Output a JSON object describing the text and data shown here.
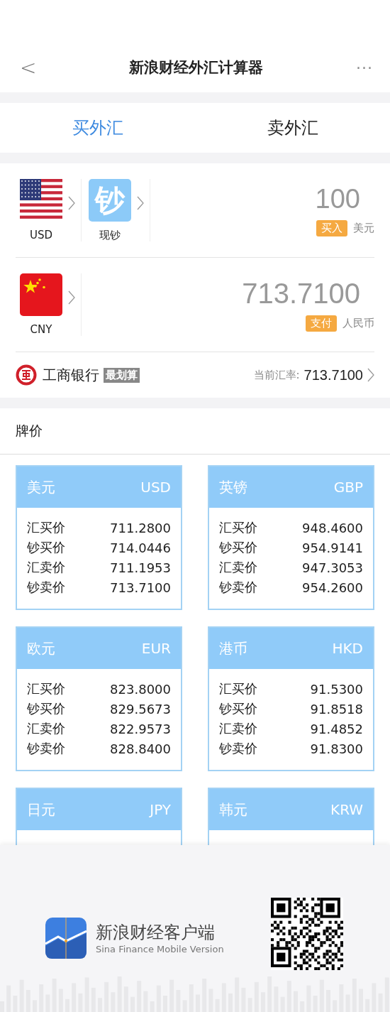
{
  "header": {
    "back": "<",
    "title": "新浪财经外汇计算器",
    "more": "···"
  },
  "tabs": [
    {
      "label": "买外汇",
      "selected": true
    },
    {
      "label": "卖外汇",
      "selected": false
    }
  ],
  "converter": {
    "from": {
      "code": "USD",
      "type_char": "钞",
      "type_label": "现钞",
      "amount": "100",
      "action": "买入",
      "currency": "美元"
    },
    "to": {
      "code": "CNY",
      "amount": "713.7100",
      "action": "支付",
      "currency": "人民币"
    },
    "bank": {
      "name": "工商银行",
      "tag": "最划算",
      "rate_label": "当前汇率:",
      "rate": "713.7100"
    }
  },
  "prices": {
    "title": "牌价",
    "cards": [
      {
        "name": "美元",
        "code": "USD",
        "rows": [
          {
            "label": "汇买价",
            "value": "711.2800"
          },
          {
            "label": "钞买价",
            "value": "714.0446"
          },
          {
            "label": "汇卖价",
            "value": "711.1953"
          },
          {
            "label": "钞卖价",
            "value": "713.7100"
          }
        ]
      },
      {
        "name": "英镑",
        "code": "GBP",
        "rows": [
          {
            "label": "汇买价",
            "value": "948.4600"
          },
          {
            "label": "钞买价",
            "value": "954.9141"
          },
          {
            "label": "汇卖价",
            "value": "947.3053"
          },
          {
            "label": "钞卖价",
            "value": "954.2600"
          }
        ]
      },
      {
        "name": "欧元",
        "code": "EUR",
        "rows": [
          {
            "label": "汇买价",
            "value": "823.8000"
          },
          {
            "label": "钞买价",
            "value": "829.5673"
          },
          {
            "label": "汇卖价",
            "value": "822.9573"
          },
          {
            "label": "钞卖价",
            "value": "828.8400"
          }
        ]
      },
      {
        "name": "港币",
        "code": "HKD",
        "rows": [
          {
            "label": "汇买价",
            "value": "91.5300"
          },
          {
            "label": "钞买价",
            "value": "91.8518"
          },
          {
            "label": "汇卖价",
            "value": "91.4852"
          },
          {
            "label": "钞卖价",
            "value": "91.8300"
          }
        ]
      },
      {
        "name": "日元",
        "code": "JPY"
      },
      {
        "name": "韩元",
        "code": "KRW"
      }
    ]
  },
  "footer": {
    "app_name": "新浪财经客户端",
    "app_subtitle": "Sina Finance Mobile Version"
  }
}
